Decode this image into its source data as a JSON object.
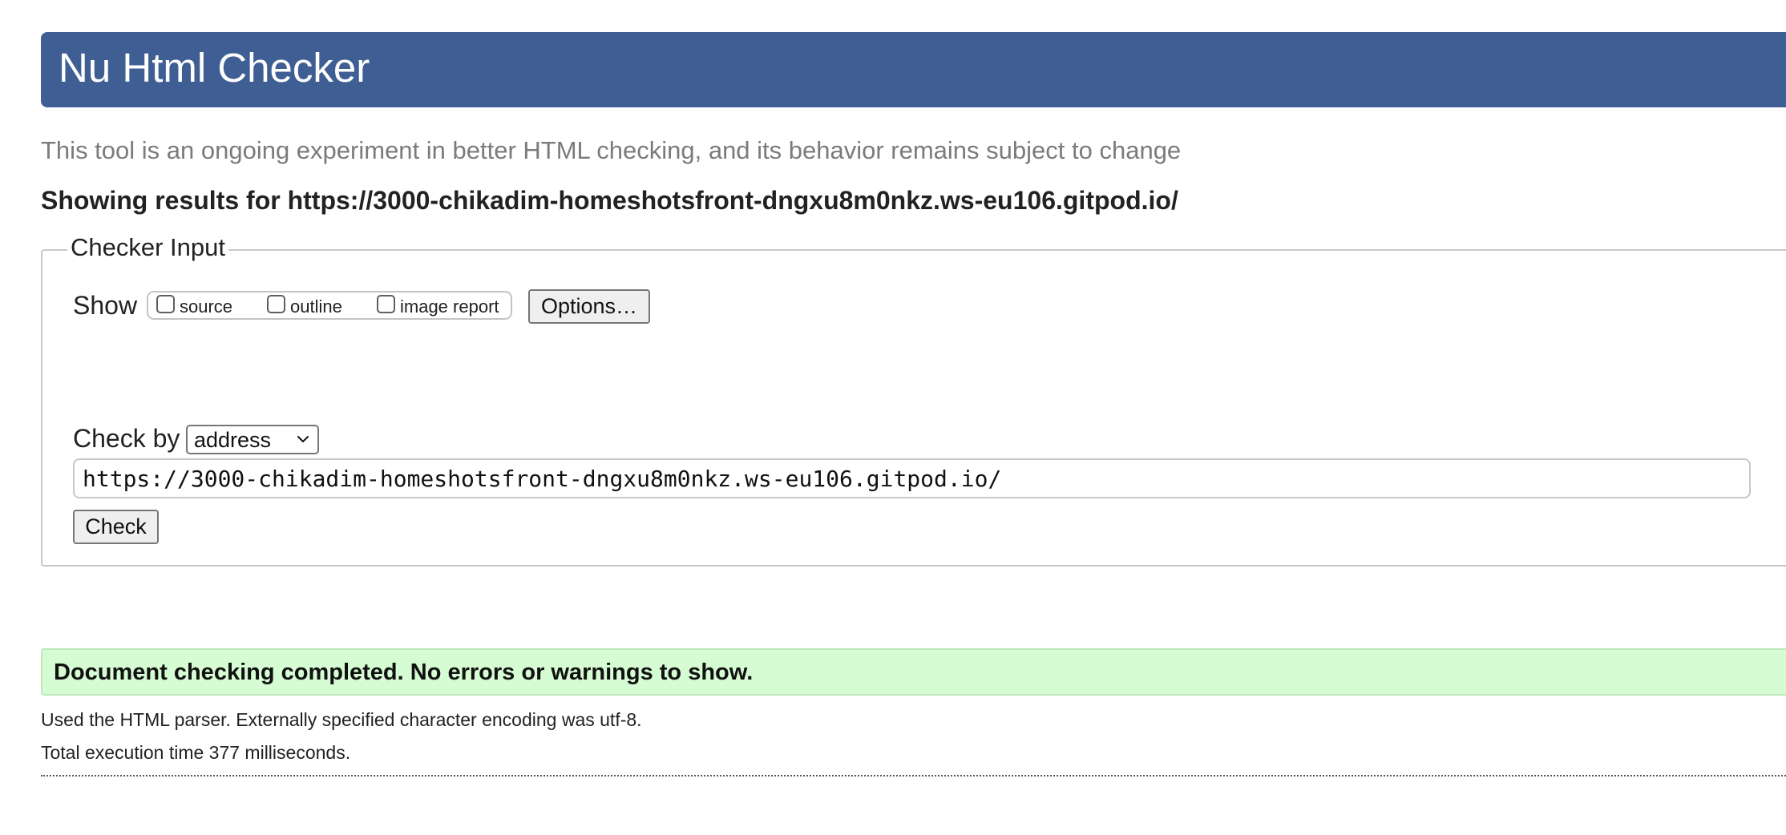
{
  "header": {
    "title": "Nu Html Checker"
  },
  "intro": "This tool is an ongoing experiment in better HTML checking, and its behavior remains subject to change",
  "results_heading": "Showing results for https://3000-chikadim-homeshotsfront-dngxu8m0nkz.ws-eu106.gitpod.io/",
  "checker_input": {
    "legend": "Checker Input",
    "show_label": "Show",
    "checkboxes": [
      {
        "label": "source",
        "checked": false
      },
      {
        "label": "outline",
        "checked": false
      },
      {
        "label": "image report",
        "checked": false
      }
    ],
    "options_button": "Options…",
    "check_by_label": "Check by",
    "check_by_value": "address",
    "url_value": "https://3000-chikadim-homeshotsfront-dngxu8m0nkz.ws-eu106.gitpod.io/",
    "check_button": "Check"
  },
  "result": {
    "success_message": "Document checking completed. No errors or warnings to show.",
    "parser_info": "Used the HTML parser. Externally specified character encoding was utf-8.",
    "execution_time": "Total execution time 377 milliseconds."
  },
  "colors": {
    "header_bg": "#3f5f94",
    "success_bg": "#d5fcd2",
    "intro_text": "#7b7b7b"
  }
}
